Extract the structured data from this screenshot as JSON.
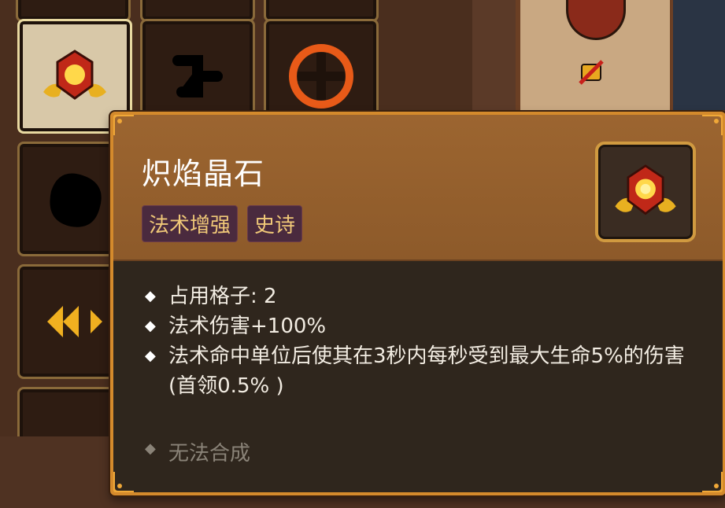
{
  "item": {
    "name": "炽焰晶石",
    "tags": [
      "法术增强",
      "史诗"
    ],
    "icon": "flame-crystal-icon",
    "stats": [
      "占用格子: 2",
      "法术伤害+100%",
      "法术命中单位后使其在3秒内每秒受到最大生命5%的伤害(首领0.5% )"
    ],
    "footer": "无法合成"
  },
  "colors": {
    "tooltip_border": "#d48a2c",
    "header_bg": "#9c6530",
    "body_bg": "#2f261d",
    "tag_bg": "#4a2a3e",
    "tag_text": "#f0c878"
  }
}
